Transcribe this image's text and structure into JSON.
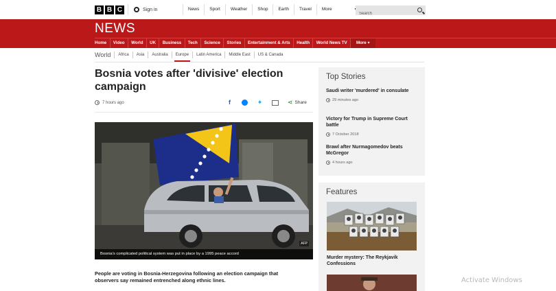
{
  "brand": {
    "bbc_letters": [
      "B",
      "B",
      "C"
    ],
    "news_logo": "NEWS",
    "news_color": "#bb1919"
  },
  "account": {
    "signin_label": "Sign in",
    "icon": "person-icon"
  },
  "top_nav": [
    "News",
    "Sport",
    "Weather",
    "Shop",
    "Earth",
    "Travel",
    "More"
  ],
  "search": {
    "placeholder": "Search",
    "icon": "search-icon"
  },
  "news_nav": [
    "Home",
    "Video",
    "World",
    "UK",
    "Business",
    "Tech",
    "Science",
    "Stories",
    "Entertainment & Arts",
    "Health",
    "World News TV",
    "More"
  ],
  "sub_nav": {
    "section": "World",
    "items": [
      "Africa",
      "Asia",
      "Australia",
      "Europe",
      "Latin America",
      "Middle East",
      "US & Canada"
    ],
    "active": "Europe"
  },
  "article": {
    "headline": "Bosnia votes after 'divisive' election campaign",
    "timestamp": "7 hours ago",
    "share_label": "Share",
    "share_icons": [
      "facebook-icon",
      "messenger-icon",
      "twitter-icon",
      "email-icon",
      "share-icon"
    ],
    "image_caption": "Bosnia's complicated political system was put in place by a 1995 peace accord",
    "image_credit": "AFP",
    "body": "People are voting in Bosnia-Herzegovina following an election campaign that observers say remained entrenched along ethnic lines."
  },
  "top_stories": {
    "title": "Top Stories",
    "items": [
      {
        "title": "Saudi writer 'murdered' in consulate",
        "time": "29 minutes ago"
      },
      {
        "title": "Victory for Trump in Supreme Court battle",
        "time": "7 October 2018"
      },
      {
        "title": "Brawl after Nurmagomedov beats McGregor",
        "time": "4 hours ago"
      }
    ]
  },
  "features": {
    "title": "Features",
    "items": [
      {
        "title": "Murder mystery: The Reykjavik Confessions"
      }
    ]
  },
  "os_overlay": {
    "watermark": "Activate Windows"
  }
}
